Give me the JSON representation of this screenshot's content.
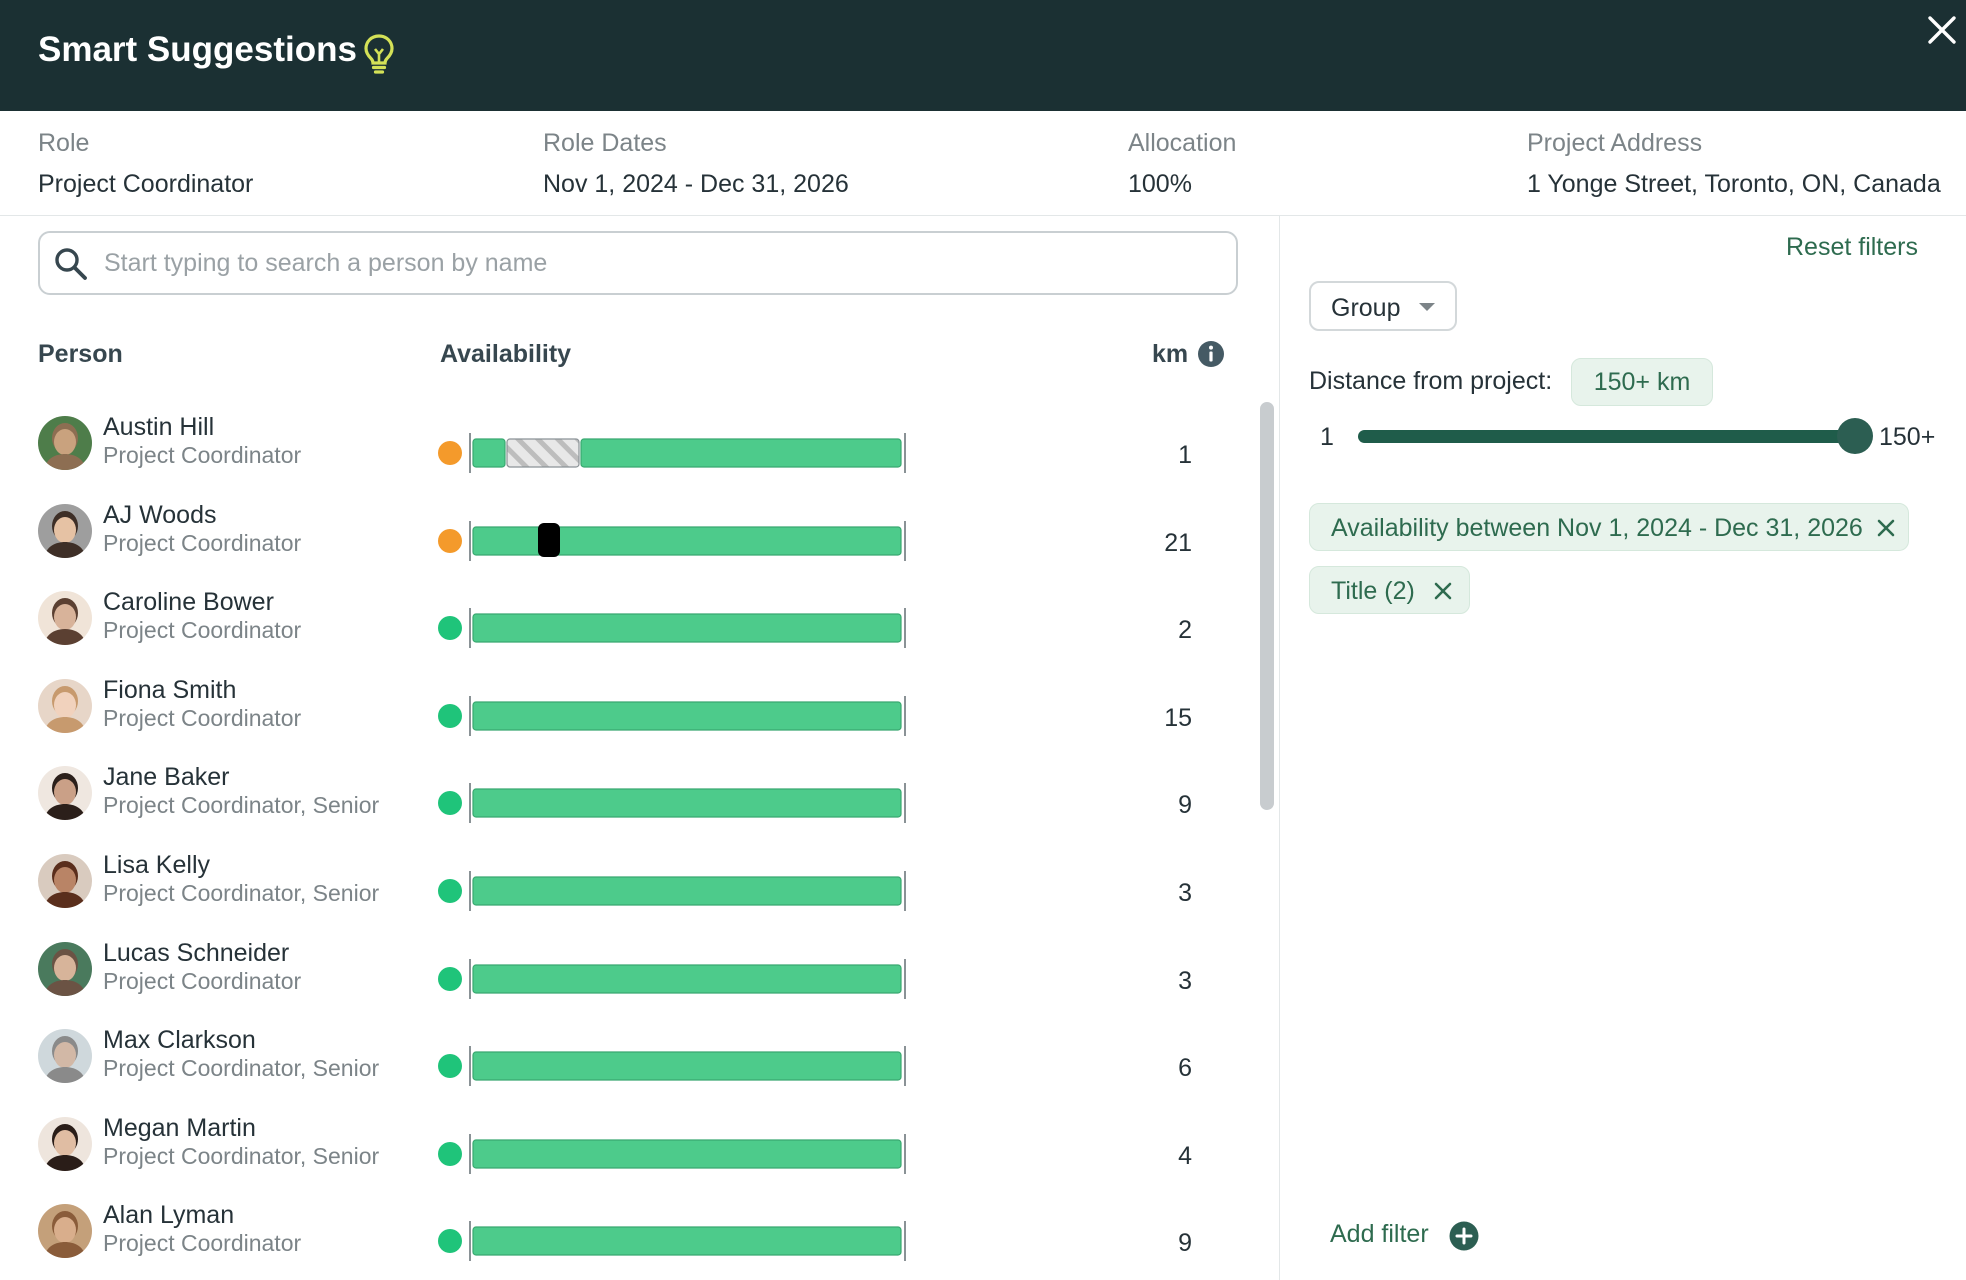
{
  "header": {
    "title": "Smart Suggestions",
    "icon": "lightbulb-icon",
    "close_icon": "close-icon",
    "background": "#1b3033"
  },
  "role_info": {
    "role": {
      "label": "Role",
      "value": "Project Coordinator"
    },
    "dates": {
      "label": "Role Dates",
      "value": "Nov 1, 2024 - Dec 31, 2026"
    },
    "allocation": {
      "label": "Allocation",
      "value": "100%"
    },
    "address": {
      "label": "Project Address",
      "value": "1 Yonge Street, Toronto, ON, Canada"
    }
  },
  "search": {
    "placeholder": "Start typing to search a person by name",
    "value": ""
  },
  "columns": {
    "person": "Person",
    "availability": "Availability",
    "km": "km"
  },
  "colors": {
    "available": "#1fc47a",
    "partial": "#f49a2b",
    "bar_fill": "#4dcb8b",
    "accent": "#2e6b4f"
  },
  "people": [
    {
      "name": "Austin Hill",
      "title": "Project Coordinator",
      "status": "partial",
      "km": "1"
    },
    {
      "name": "AJ Woods",
      "title": "Project Coordinator",
      "status": "partial",
      "km": "21"
    },
    {
      "name": "Caroline Bower",
      "title": "Project Coordinator",
      "status": "available",
      "km": "2"
    },
    {
      "name": "Fiona Smith",
      "title": "Project Coordinator",
      "status": "available",
      "km": "15"
    },
    {
      "name": "Jane Baker",
      "title": "Project Coordinator, Senior",
      "status": "available",
      "km": "9"
    },
    {
      "name": "Lisa Kelly",
      "title": "Project Coordinator, Senior",
      "status": "available",
      "km": "3"
    },
    {
      "name": "Lucas Schneider",
      "title": "Project Coordinator",
      "status": "available",
      "km": "3"
    },
    {
      "name": "Max Clarkson",
      "title": "Project Coordinator, Senior",
      "status": "available",
      "km": "6"
    },
    {
      "name": "Megan Martin",
      "title": "Project Coordinator, Senior",
      "status": "available",
      "km": "4"
    },
    {
      "name": "Alan Lyman",
      "title": "Project Coordinator",
      "status": "available",
      "km": "9"
    }
  ],
  "filters": {
    "reset_label": "Reset filters",
    "group_label": "Group",
    "distance_label": "Distance from project:",
    "distance_value": "150+ km",
    "slider_min": "1",
    "slider_max": "150+",
    "chips": [
      {
        "label": "Availability between Nov 1, 2024 - Dec 31, 2026"
      },
      {
        "label": "Title (2)"
      }
    ],
    "add_label": "Add filter"
  }
}
